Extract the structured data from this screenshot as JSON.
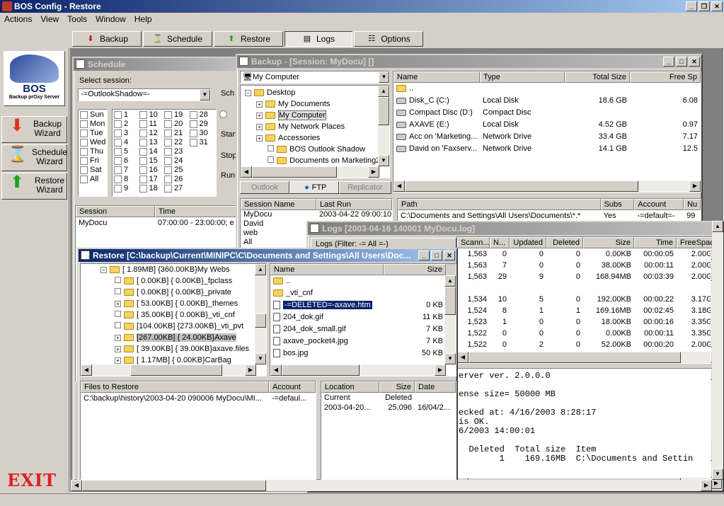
{
  "app": {
    "title": "BOS Config - Restore"
  },
  "menu": [
    "Actions",
    "View",
    "Tools",
    "Window",
    "Help"
  ],
  "toolbar": [
    "Backup",
    "Schedule",
    "Restore",
    "Logs",
    "Options"
  ],
  "sidebar": {
    "logo_text": "BOS",
    "logo_sub": "Backup prOxy Server",
    "wizards": [
      {
        "l1": "Backup",
        "l2": "Wizard"
      },
      {
        "l1": "Schedule",
        "l2": "Wizard"
      },
      {
        "l1": "Restore",
        "l2": "Wizard"
      }
    ],
    "exit": "EXIT"
  },
  "schedule": {
    "title": "Schedule",
    "select_label": "Select session:",
    "session_value": "-=OutlookShadow=-",
    "days": [
      "Sun",
      "Mon",
      "Tue",
      "Wed",
      "Thu",
      "Fri",
      "Sat",
      "All"
    ],
    "dates": [
      [
        "1",
        "10",
        "19",
        "28"
      ],
      [
        "2",
        "11",
        "20",
        "29"
      ],
      [
        "3",
        "12",
        "21",
        "30"
      ],
      [
        "4",
        "13",
        "22",
        "31"
      ],
      [
        "5",
        "14",
        "23",
        ""
      ],
      [
        "6",
        "15",
        "24",
        ""
      ],
      [
        "7",
        "16",
        "25",
        ""
      ],
      [
        "8",
        "17",
        "26",
        ""
      ],
      [
        "9",
        "18",
        "27",
        ""
      ]
    ],
    "right_labels": [
      "Sch",
      "Start",
      "Stop",
      "Run"
    ],
    "cols": [
      "Session",
      "Time"
    ],
    "rows": [
      [
        "MyDocu",
        "07:00:00 - 23:00:00; e"
      ]
    ]
  },
  "backup": {
    "title": "Backup - [Session: MyDocu] []",
    "combo": "My Computer",
    "tree": [
      "Desktop",
      "My Documents",
      "My Computer",
      "My Network Places",
      "Accessories",
      "BOS Outlook Shadow",
      "Documents on Marketing2000"
    ],
    "drive_cols": [
      "Name",
      "Type",
      "Total Size",
      "Free Sp"
    ],
    "drives": [
      [
        "..",
        "",
        "",
        ""
      ],
      [
        "Disk_C (C:)",
        "Local Disk",
        "18.6 GB",
        "6.08"
      ],
      [
        "Compact Disc (D:)",
        "Compact Disc",
        "",
        ""
      ],
      [
        "AXAVE (E:)",
        "Local Disk",
        "4.52 GB",
        "0.97"
      ],
      [
        "Acc on 'Marketing...",
        "Network Drive",
        "33.4 GB",
        "7.17"
      ],
      [
        "David on 'Faxserv...",
        "Network Drive",
        "14.1 GB",
        "12.5"
      ]
    ],
    "tabs": [
      "Outlook",
      "FTP",
      "Replicator"
    ],
    "session_cols": [
      "Session Name",
      "Last Run"
    ],
    "sessions": [
      [
        "MyDocu",
        "2003-04-22 09:00:10"
      ],
      [
        "David",
        ""
      ],
      [
        "web",
        ""
      ],
      [
        "All",
        ""
      ]
    ],
    "path_cols": [
      "Path",
      "Subs",
      "Account",
      "Nu"
    ],
    "paths": [
      [
        "C:\\Documents and Settings\\All Users\\Documents\\*.*",
        "Yes",
        "-=default=-",
        "99"
      ]
    ]
  },
  "logs": {
    "title": "Logs  [2003-04-16 140001 MyDocu.log]",
    "filter": "Logs (Filter: -= All =-)",
    "cols": [
      "Scann...",
      "N...",
      "Updated",
      "Deleted",
      "Size",
      "Time",
      "FreeSpace"
    ],
    "rows": [
      [
        "1,563",
        "0",
        "0",
        "0",
        "0.00KB",
        "00:00:05",
        "2.00GB"
      ],
      [
        "1,563",
        "7",
        "0",
        "0",
        "38.00KB",
        "00:00:11",
        "2.00GB"
      ],
      [
        "1,563",
        "29",
        "9",
        "0",
        "168.94MB",
        "00:03:39",
        "2.00GB"
      ],
      [
        "",
        "",
        "",
        "",
        "",
        "",
        ""
      ],
      [
        "1,534",
        "10",
        "5",
        "0",
        "192.00KB",
        "00:00:22",
        "3.17GB"
      ],
      [
        "1,524",
        "8",
        "1",
        "1",
        "169.16MB",
        "00:02:45",
        "3.18GB"
      ],
      [
        "1,523",
        "1",
        "0",
        "0",
        "18.00KB",
        "00:00:16",
        "3.35GB"
      ],
      [
        "1,522",
        "0",
        "0",
        "0",
        "0.00KB",
        "00:00:11",
        "3.35GB"
      ],
      [
        "1,522",
        "0",
        "2",
        "0",
        "52.00KB",
        "00:00:20",
        "2.00GB"
      ]
    ],
    "text_lines": [
      "erver ver. 2.0.0.0",
      "",
      "ense size= 50000 MB",
      "",
      "ecked at: 4/16/2003 8:28:17",
      "is OK.",
      "6/2003 14:00:01",
      "",
      "  Deleted  Total size  Item",
      "        1    169.16MB  C:\\Documents and Settin"
    ]
  },
  "restore": {
    "title": "Restore [C:\\backup\\Current\\MINIPC\\C\\Documents and Settings\\All Users\\Doc...",
    "tree": [
      "[  1.89MB] {360.00KB}My Webs",
      "[  0.00KB] {  0.00KB}_fpclass",
      "[  0.00KB] {  0.00KB}_private",
      "[ 53.00KB] {  0.00KB}_themes",
      "[ 35.00KB] {  0.00KB}_vti_cnf",
      "[104.00KB] {273.00KB}_vti_pvt",
      "[267.00KB] { 24.00KB}Axave",
      "[ 39.00KB] { 39.00KB}axave.files",
      "[  1.17MB] {  0.00KB}CarBag"
    ],
    "file_cols": [
      "Name",
      "Size"
    ],
    "files": [
      [
        "..",
        ""
      ],
      [
        "_vti_cnf",
        ""
      ],
      [
        "-=DELETED=-axave.htm",
        "0 KB"
      ],
      [
        "204_dok.gif",
        "11 KB"
      ],
      [
        "204_dok_small.gif",
        "7 KB"
      ],
      [
        "axave_pocket4.jpg",
        "7 KB"
      ],
      [
        "bos.jpg",
        "50 KB"
      ]
    ],
    "ftr_cols": [
      "Files to Restore",
      "Account"
    ],
    "ftr_rows": [
      [
        "C:\\backup\\history\\2003-04-20 090006 MyDocu\\MI...",
        "-=defaul..."
      ]
    ],
    "loc_cols": [
      "Location",
      "Size",
      "Date"
    ],
    "loc_rows": [
      [
        "Current",
        "Deleted",
        ""
      ],
      [
        "2003-04-20...",
        "25,096",
        "16/04/2..."
      ]
    ]
  }
}
